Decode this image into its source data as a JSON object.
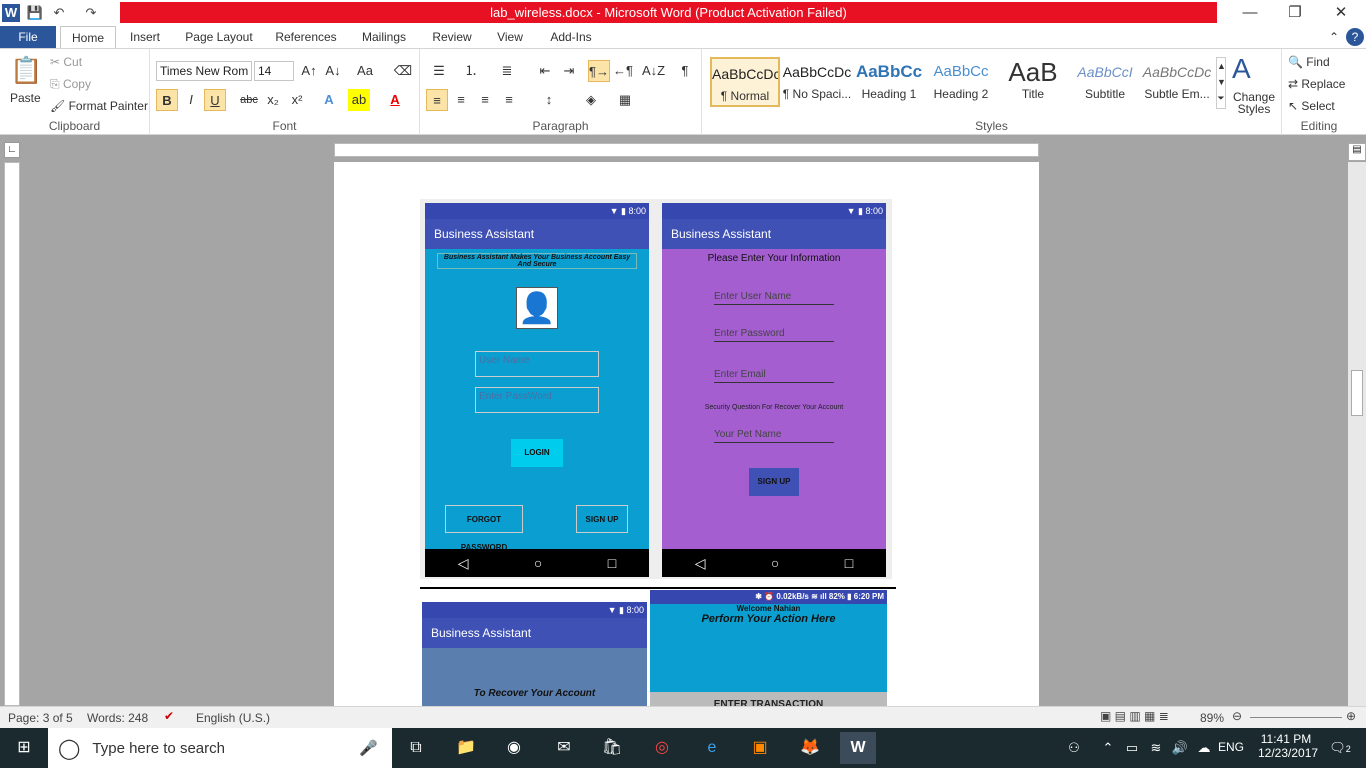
{
  "window": {
    "title": "lab_wireless.docx  -  Microsoft Word (Product Activation Failed)",
    "minimize": "—",
    "restore": "❐",
    "close": "✕"
  },
  "qat": {
    "word_icon": "W",
    "save": "💾",
    "undo": "↶",
    "redo": "↷"
  },
  "tabs": [
    "File",
    "Home",
    "Insert",
    "Page Layout",
    "References",
    "Mailings",
    "Review",
    "View",
    "Add-Ins"
  ],
  "ribbon": {
    "clipboard": {
      "label": "Clipboard",
      "paste": "Paste",
      "cut": "Cut",
      "copy": "Copy",
      "format_painter": "Format Painter"
    },
    "font": {
      "label": "Font",
      "family": "Times New Rom",
      "size": "14",
      "bold": "B",
      "italic": "I",
      "underline": "U",
      "strike": "abc",
      "sub": "x₂",
      "sup": "x²"
    },
    "paragraph": {
      "label": "Paragraph"
    },
    "styles": {
      "label": "Styles",
      "items": [
        {
          "preview": "AaBbCcDc",
          "name": "¶ Normal"
        },
        {
          "preview": "AaBbCcDc",
          "name": "¶ No Spaci..."
        },
        {
          "preview": "AaBbCc",
          "name": "Heading 1"
        },
        {
          "preview": "AaBbCc",
          "name": "Heading 2"
        },
        {
          "preview": "AaB",
          "name": "Title"
        },
        {
          "preview": "AaBbCcI",
          "name": "Subtitle"
        },
        {
          "preview": "AaBbCcDc",
          "name": "Subtle Em..."
        }
      ],
      "change_styles": "Change Styles"
    },
    "editing": {
      "label": "Editing",
      "find": "Find",
      "replace": "Replace",
      "select": "Select"
    }
  },
  "doc": {
    "screen1": {
      "time": "8:00",
      "title": "Business Assistant",
      "tagline": "Business Assistant Makes Your Business Account Easy And Secure",
      "user_placeholder": "User Name",
      "pass_placeholder": "Enter PassWord",
      "login": "LOGIN",
      "forgot": "FORGOT PASSWORD",
      "signup": "SIGN UP"
    },
    "screen2": {
      "time": "8:00",
      "title": "Business Assistant",
      "heading": "Please Enter Your Information",
      "user": "Enter User Name",
      "pass": "Enter Password",
      "email": "Enter Email",
      "security": "Security Question For Recover Your Account",
      "pet": "Your Pet Name",
      "signup": "SIGN UP"
    },
    "screen3": {
      "time": "8:00",
      "title": "Business Assistant",
      "recover": "To Recover Your Account"
    },
    "screen4": {
      "status": "✱ ⏰ 0.02kB/s ≋ ıll 82% ▮ 6:20 PM",
      "welcome": "Welcome Nahian",
      "action": "Perform Your Action Here",
      "enter": "ENTER TRANSACTION"
    }
  },
  "status": {
    "page": "Page: 3 of 5",
    "words": "Words: 248",
    "language": "English (U.S.)",
    "zoom": "89%"
  },
  "taskbar": {
    "search": "Type here to search",
    "lang": "ENG",
    "time": "11:41 PM",
    "date": "12/23/2017",
    "notif": "2"
  }
}
